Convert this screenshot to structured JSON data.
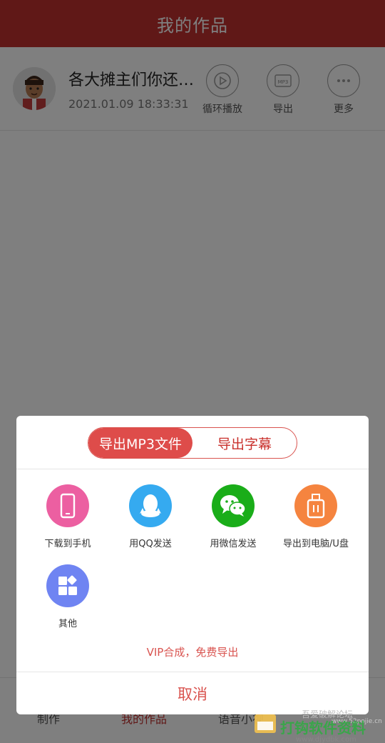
{
  "header": {
    "title": "我的作品"
  },
  "work": {
    "title": "各大摊主们你还…",
    "date": "2021.01.09 18:33:31",
    "actions": [
      {
        "label": "循环播放",
        "icon": "loop-play-icon"
      },
      {
        "label": "导出",
        "icon": "mp3-export-icon",
        "badge": "MP3"
      },
      {
        "label": "更多",
        "icon": "more-icon"
      }
    ]
  },
  "tabs": [
    "制作",
    "我的作品",
    "语音小视"
  ],
  "sheet": {
    "segments": [
      "导出MP3文件",
      "导出字幕"
    ],
    "active_segment": 0,
    "share_targets": [
      {
        "label": "下载到手机",
        "icon": "phone-icon",
        "color": "#ec5fa1"
      },
      {
        "label": "用QQ发送",
        "icon": "qq-icon",
        "color": "#35aaf0"
      },
      {
        "label": "用微信发送",
        "icon": "wechat-icon",
        "color": "#1aad19"
      },
      {
        "label": "导出到电脑/U盘",
        "icon": "usb-drive-icon",
        "color": "#f5843f"
      },
      {
        "label": "其他",
        "icon": "apps-icon",
        "color": "#6f84f2"
      }
    ],
    "vip_text": "VIP合成，免费导出",
    "cancel_label": "取消"
  },
  "watermark": {
    "text": "吾爱破解论坛",
    "site": "www.52pojie.cn",
    "brand": "打钩软件资料",
    "url": "www.djydbk.com"
  },
  "colors": {
    "accent": "#c0312f",
    "segment": "#de4c4a"
  }
}
